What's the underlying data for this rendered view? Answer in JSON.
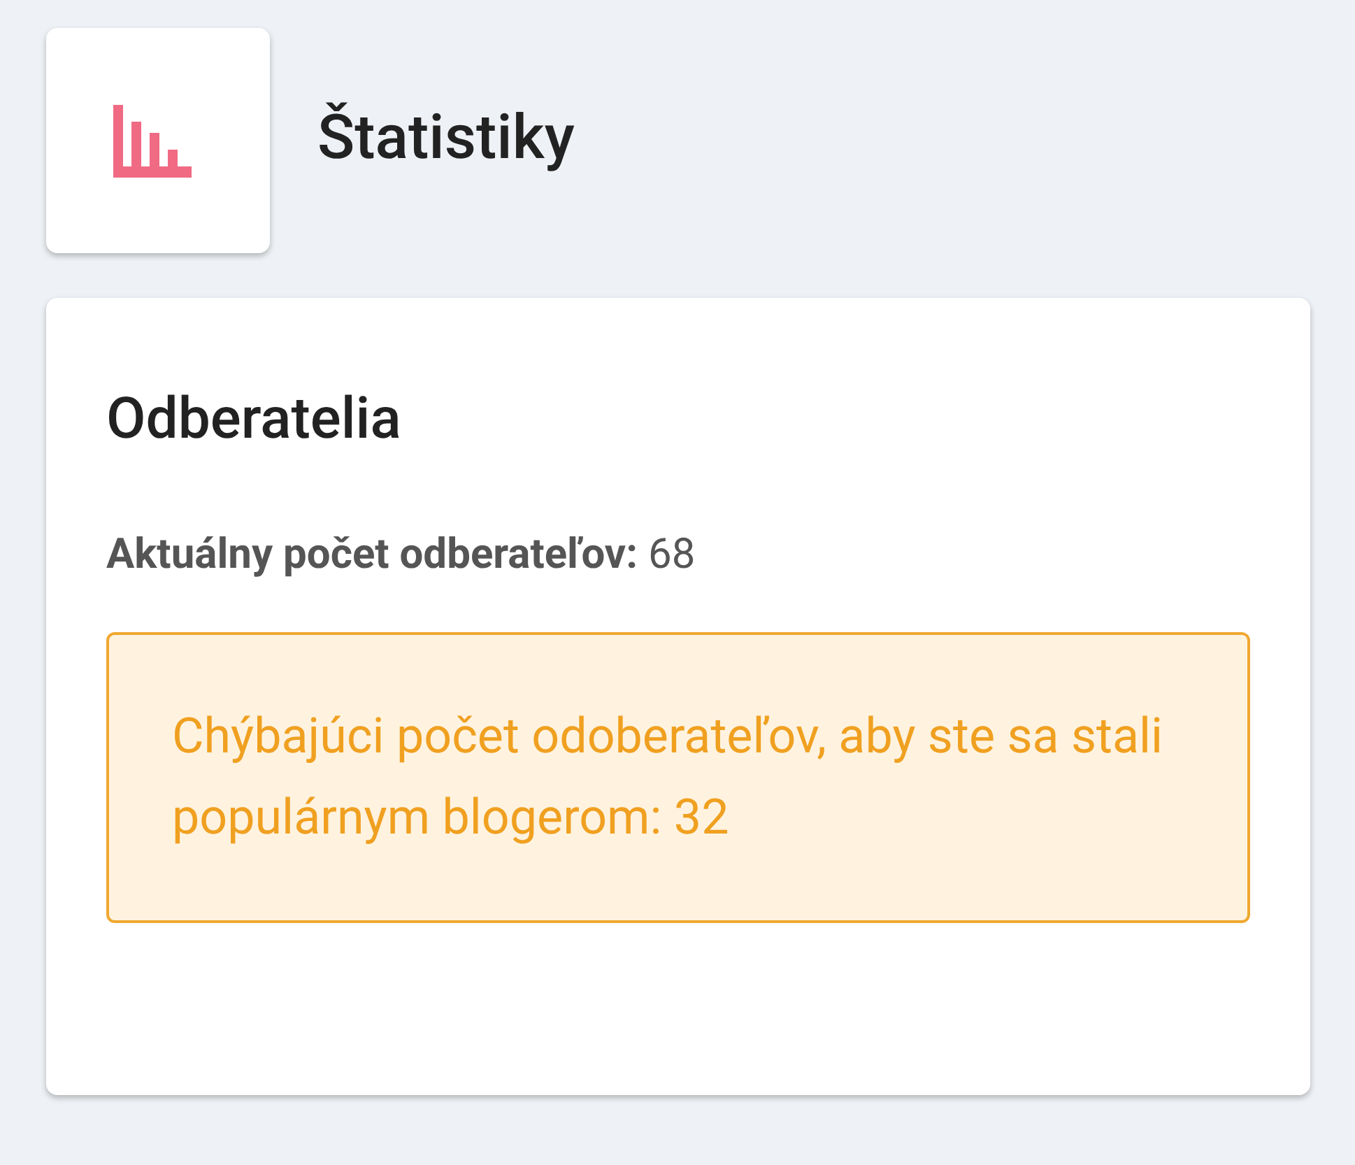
{
  "header": {
    "title": "Štatistiky"
  },
  "card": {
    "title": "Odberatelia",
    "stat": {
      "label": "Aktuálny počet odberateľov:",
      "value": "68"
    },
    "alert": {
      "kind": "warning",
      "text": "Chýbajúci počet odoberateľov, aby ste sa stali populárnym blogerom: 32"
    }
  }
}
